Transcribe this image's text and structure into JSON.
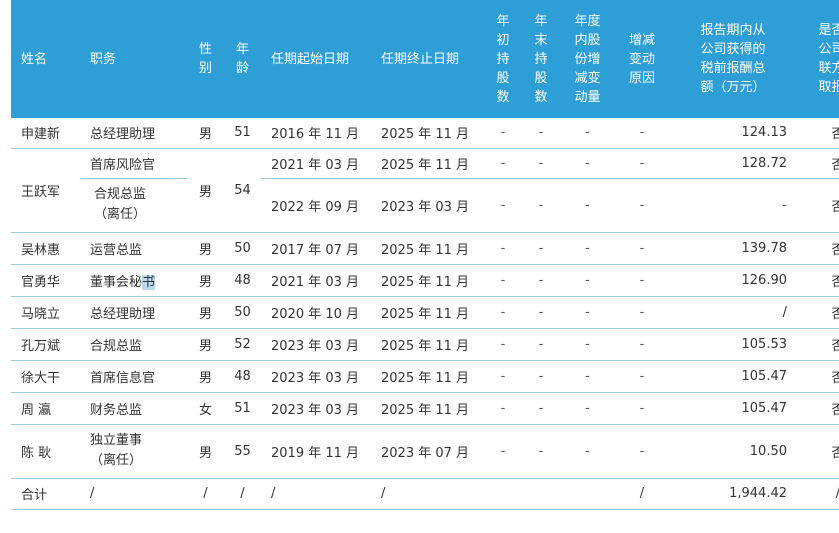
{
  "headers": {
    "name": "姓名",
    "position": "职务",
    "gender": "性\n别",
    "age": "年\n龄",
    "start": "任期起始日期",
    "end": "任期终止日期",
    "shares_begin": "年\n初\n持\n股\n数",
    "shares_end": "年\n末\n持\n股\n数",
    "shares_change": "年度\n内股\n份增\n减变\n动量",
    "change_reason": "增减\n变动\n原因",
    "pay": "报告期内从\n公司获得的\n税前报酬总\n额（万元）",
    "related_pay": "是否在\n公司关\n联方获\n取报酬"
  },
  "rows": [
    {
      "name": "申建新",
      "position": "总经理助理",
      "gender": "男",
      "age": "51",
      "start": "2016 年 11 月",
      "end": "2025 年 11 月",
      "sb": "-",
      "se": "-",
      "sc": "-",
      "reason": "-",
      "pay": "124.13",
      "related": "否"
    },
    {
      "name": "王跃军",
      "gender": "男",
      "age": "54",
      "sub": [
        {
          "position": "首席风险官",
          "start": "2021 年 03 月",
          "end": "2025 年 11 月",
          "sb": "-",
          "se": "-",
          "sc": "-",
          "reason": "-",
          "pay": "128.72",
          "related": "否"
        },
        {
          "position": "合规总监（离任）",
          "start": "2022 年 09 月",
          "end": "2023 年 03 月",
          "sb": "-",
          "se": "-",
          "sc": "-",
          "reason": "-",
          "pay": "-",
          "related": "否"
        }
      ]
    },
    {
      "name": "吴林惠",
      "position": "运营总监",
      "gender": "男",
      "age": "50",
      "start": "2017 年 07 月",
      "end": "2025 年 11 月",
      "sb": "-",
      "se": "-",
      "sc": "-",
      "reason": "-",
      "pay": "139.78",
      "related": "否"
    },
    {
      "name": "官勇华",
      "position": "董事会秘",
      "position_hl": "书",
      "gender": "男",
      "age": "48",
      "start": "2021 年 03 月",
      "end": "2025 年 11 月",
      "sb": "-",
      "se": "-",
      "sc": "-",
      "reason": "-",
      "pay": "126.90",
      "related": "否"
    },
    {
      "name": "马晓立",
      "position": "总经理助理",
      "gender": "男",
      "age": "50",
      "start": "2020 年 10 月",
      "end": "2025 年 11 月",
      "sb": "-",
      "se": "-",
      "sc": "-",
      "reason": "-",
      "pay": "/",
      "related": "否"
    },
    {
      "name": "孔万斌",
      "position": "合规总监",
      "gender": "男",
      "age": "52",
      "start": "2023 年 03 月",
      "end": "2025 年 11 月",
      "sb": "-",
      "se": "-",
      "sc": "-",
      "reason": "-",
      "pay": "105.53",
      "related": "否"
    },
    {
      "name": "徐大干",
      "position": "首席信息官",
      "gender": "男",
      "age": "48",
      "start": "2023 年 03 月",
      "end": "2025 年 11 月",
      "sb": "-",
      "se": "-",
      "sc": "-",
      "reason": "-",
      "pay": "105.47",
      "related": "否"
    },
    {
      "name": "周 瀛",
      "position": "财务总监",
      "gender": "女",
      "age": "51",
      "start": "2023 年 03 月",
      "end": "2025 年 11 月",
      "sb": "-",
      "se": "-",
      "sc": "-",
      "reason": "-",
      "pay": "105.47",
      "related": "否"
    },
    {
      "name": "陈 耿",
      "position": "独立董事（离任）",
      "gender": "男",
      "age": "55",
      "start": "2019 年 11 月",
      "end": "2023 年 07 月",
      "sb": "-",
      "se": "-",
      "sc": "-",
      "reason": "-",
      "pay": "10.50",
      "related": "否"
    }
  ],
  "total": {
    "name": "合计",
    "position": "/",
    "gender": "/",
    "age": "/",
    "start": "/",
    "end": "/",
    "sb": "",
    "se": "",
    "sc": "",
    "reason": "/",
    "pay": "1,944.42",
    "related": "/"
  }
}
